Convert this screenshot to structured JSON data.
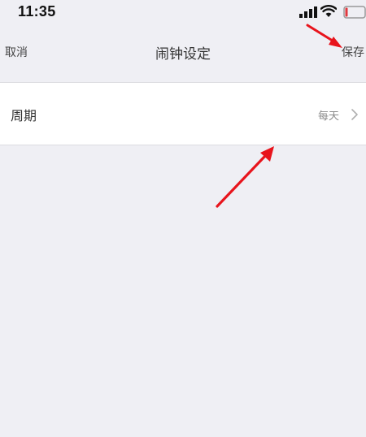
{
  "status_bar": {
    "time": "11:35"
  },
  "nav": {
    "cancel_label": "取消",
    "title": "闹钟设定",
    "save_label": "保存"
  },
  "settings": {
    "rows": [
      {
        "label": "周期",
        "value": "每天"
      }
    ]
  },
  "colors": {
    "background": "#efeff4",
    "row_background": "#ffffff",
    "annotation_arrow": "#e8141c"
  }
}
